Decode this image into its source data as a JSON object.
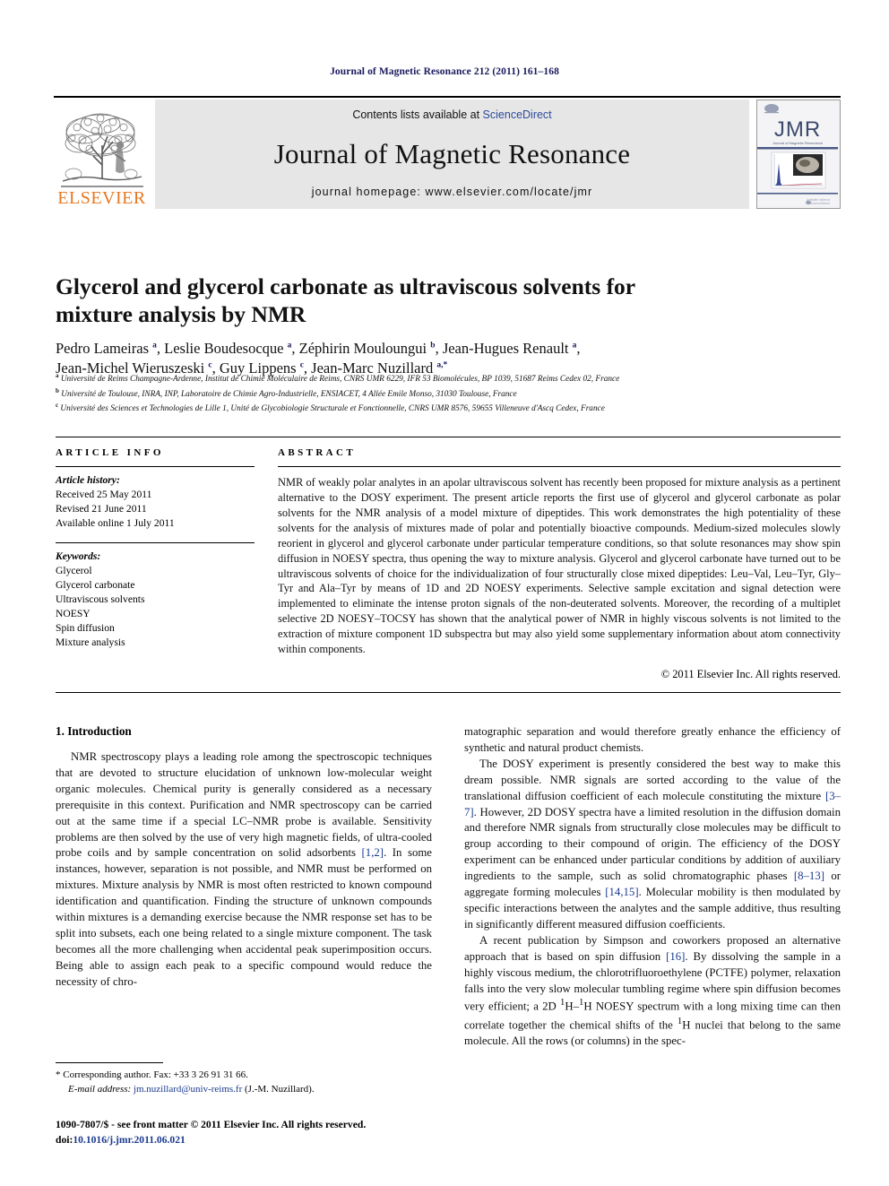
{
  "running_head": "Journal of Magnetic Resonance 212 (2011) 161–168",
  "masthead": {
    "publisher_logo_text": "ELSEVIER",
    "contents_prefix": "Contents lists available at",
    "contents_link": "ScienceDirect",
    "journal_name": "Journal of Magnetic Resonance",
    "homepage_line": "journal homepage: www.elsevier.com/locate/jmr",
    "cover_title": "JMR",
    "cover_subtitle": "Journal of Magnetic Resonance"
  },
  "article": {
    "title": "Glycerol and glycerol carbonate as ultraviscous solvents for mixture analysis by NMR",
    "authors_line_1": "Pedro Lameiras <sup>a</sup>, Leslie Boudesocque <sup>a</sup>, Zéphirin Mouloungui <sup>b</sup>, Jean-Hugues Renault <sup>a</sup>,",
    "authors_line_2": "Jean-Michel Wieruszeski <sup>c</sup>, Guy Lippens <sup>c</sup>, Jean-Marc Nuzillard <sup>a,</sup><sup>*</sup>",
    "affiliations": [
      "<sup>a</sup> Université de Reims Champagne-Ardenne, Institut de Chimie Moléculaire de Reims, CNRS UMR 6229, IFR 53 Biomolécules, BP 1039, 51687 Reims Cedex 02, France",
      "<sup>b</sup> Université de Toulouse, INRA, INP, Laboratoire de Chimie Agro-Industrielle, ENSIACET, 4 Allée Emile Monso, 31030 Toulouse, France",
      "<sup>c</sup> Université des Sciences et Technologies de Lille 1, Unité de Glycobiologie Structurale et Fonctionnelle, CNRS UMR 8576, 59655 Villeneuve d'Ascq Cedex, France"
    ]
  },
  "article_info": {
    "heading": "ARTICLE INFO",
    "history_label": "Article history:",
    "history": [
      "Received 25 May 2011",
      "Revised 21 June 2011",
      "Available online 1 July 2011"
    ],
    "keywords_label": "Keywords:",
    "keywords": [
      "Glycerol",
      "Glycerol carbonate",
      "Ultraviscous solvents",
      "NOESY",
      "Spin diffusion",
      "Mixture analysis"
    ]
  },
  "abstract": {
    "heading": "ABSTRACT",
    "text": "NMR of weakly polar analytes in an apolar ultraviscous solvent has recently been proposed for mixture analysis as a pertinent alternative to the DOSY experiment. The present article reports the first use of glycerol and glycerol carbonate as polar solvents for the NMR analysis of a model mixture of dipeptides. This work demonstrates the high potentiality of these solvents for the analysis of mixtures made of polar and potentially bioactive compounds. Medium-sized molecules slowly reorient in glycerol and glycerol carbonate under particular temperature conditions, so that solute resonances may show spin diffusion in NOESY spectra, thus opening the way to mixture analysis. Glycerol and glycerol carbonate have turned out to be ultraviscous solvents of choice for the individualization of four structurally close mixed dipeptides: Leu–Val, Leu–Tyr, Gly–Tyr and Ala–Tyr by means of 1D and 2D NOESY experiments. Selective sample excitation and signal detection were implemented to eliminate the intense proton signals of the non-deuterated solvents. Moreover, the recording of a multiplet selective 2D NOESY–TOCSY has shown that the analytical power of NMR in highly viscous solvents is not limited to the extraction of mixture component 1D subspectra but may also yield some supplementary information about atom connectivity within components.",
    "copyright": "© 2011 Elsevier Inc. All rights reserved."
  },
  "body": {
    "section_heading": "1. Introduction",
    "left_paragraphs": [
      "NMR spectroscopy plays a leading role among the spectroscopic techniques that are devoted to structure elucidation of unknown low-molecular weight organic molecules. Chemical purity is generally considered as a necessary prerequisite in this context. Purification and NMR spectroscopy can be carried out at the same time if a special LC–NMR probe is available. Sensitivity problems are then solved by the use of very high magnetic fields, of ultra-cooled probe coils and by sample concentration on solid adsorbents <span class=\"ref\">[1,2]</span>. In some instances, however, separation is not possible, and NMR must be performed on mixtures. Mixture analysis by NMR is most often restricted to known compound identification and quantification. Finding the structure of unknown compounds within mixtures is a demanding exercise because the NMR response set has to be split into subsets, each one being related to a single mixture component. The task becomes all the more challenging when accidental peak superimposition occurs. Being able to assign each peak to a specific compound would reduce the necessity of chro-"
    ],
    "right_paragraphs": [
      "matographic separation and would therefore greatly enhance the efficiency of synthetic and natural product chemists.",
      "The DOSY experiment is presently considered the best way to make this dream possible. NMR signals are sorted according to the value of the translational diffusion coefficient of each molecule constituting the mixture <span class=\"ref\">[3–7]</span>. However, 2D DOSY spectra have a limited resolution in the diffusion domain and therefore NMR signals from structurally close molecules may be difficult to group according to their compound of origin. The efficiency of the DOSY experiment can be enhanced under particular conditions by addition of auxiliary ingredients to the sample, such as solid chromatographic phases <span class=\"ref\">[8–13]</span> or aggregate forming molecules <span class=\"ref\">[14,15]</span>. Molecular mobility is then modulated by specific interactions between the analytes and the sample additive, thus resulting in significantly different measured diffusion coefficients.",
      "A recent publication by Simpson and coworkers proposed an alternative approach that is based on spin diffusion <span class=\"ref\">[16]</span>. By dissolving the sample in a highly viscous medium, the chlorotrifluoroethylene (PCTFE) polymer, relaxation falls into the very slow molecular tumbling regime where spin diffusion becomes very efficient; a 2D <sup>1</sup>H–<sup>1</sup>H NOESY spectrum with a long mixing time can then correlate together the chemical shifts of the <sup>1</sup>H nuclei that belong to the same molecule. All the rows (or columns) in the spec-"
    ]
  },
  "footnotes": {
    "corresponding": "* Corresponding author. Fax: +33 3 26 91 31 66.",
    "email_label": "E-mail address:",
    "email": "jm.nuzillard@univ-reims.fr",
    "email_suffix": "(J.-M. Nuzillard)."
  },
  "imprint": {
    "line1": "1090-7807/$ - see front matter © 2011 Elsevier Inc. All rights reserved.",
    "doi_label": "doi:",
    "doi": "10.1016/j.jmr.2011.06.021"
  },
  "colors": {
    "elsevier_orange": "#E87722",
    "link_blue": "#2b4a9b",
    "reference_blue": "#1a3a8f",
    "running_head_navy": "#1a1a5e",
    "band_gray": "#e6e6e6"
  }
}
